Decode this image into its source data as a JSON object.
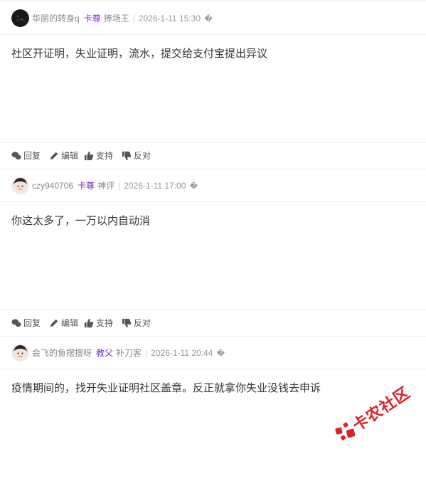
{
  "icons": {
    "reply": "comment-icon",
    "edit": "pencil-icon",
    "support": "thumbs-up-icon",
    "oppose": "thumbs-down-icon",
    "more": "replacement-char"
  },
  "colors": {
    "rank": "#7a2fd6",
    "meta": "#999999",
    "watermark": "#d9232a"
  },
  "posts": [
    {
      "username": "华丽的转身q",
      "rank": "卡尊",
      "title": "捧场王",
      "time": "2026-1-11 15:30",
      "more": "�",
      "content": "社区开证明，失业证明，流水，提交给支付宝提出异议",
      "actions": {
        "reply": "回复",
        "edit": "编辑",
        "support": "支持",
        "oppose": "反对"
      }
    },
    {
      "username": "czy940706",
      "rank": "卡尊",
      "title": "神评",
      "time": "2026-1-11 17:00",
      "more": "�",
      "content": "你这太多了，一万以内自动消",
      "actions": {
        "reply": "回复",
        "edit": "编辑",
        "support": "支持",
        "oppose": "反对"
      }
    },
    {
      "username": "会飞的鱼摆摆呀",
      "rank": "教父",
      "title": "补刀客",
      "time": "2026-1-11 20:44",
      "more": "�",
      "content": "疫情期间的，找开失业证明社区盖章。反正就拿你失业没钱去申诉"
    }
  ],
  "watermark": "卡农社区"
}
